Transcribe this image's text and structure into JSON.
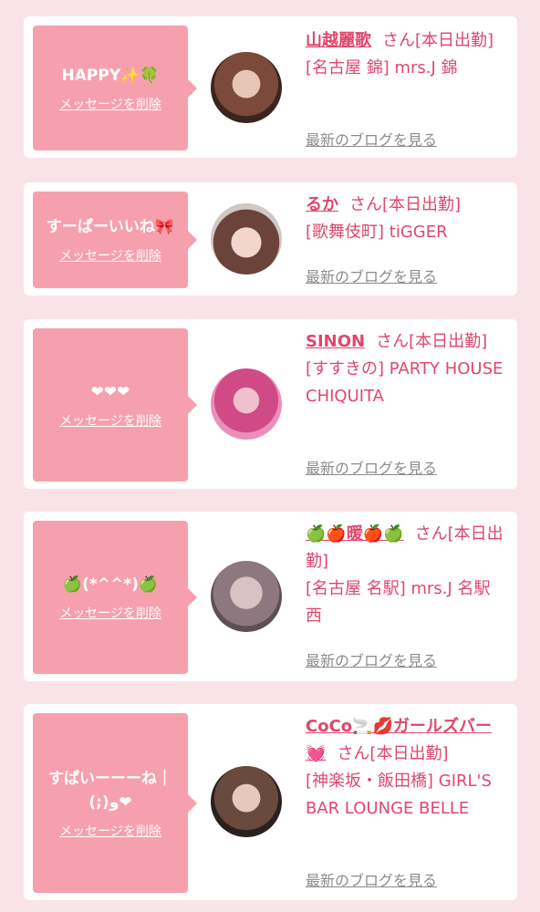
{
  "delete_label": "メッセージを削除",
  "blog_label": "最新のブログを見る",
  "suffix": "さん[本日出勤]",
  "cards": [
    {
      "message": "HAPPY✨🍀",
      "name": "山越麗歌",
      "shop": "[名古屋 錦] mrs.J 錦"
    },
    {
      "message": "すーぱーいいね🎀",
      "name": "るか",
      "shop": "[歌舞伎町] tiGGER"
    },
    {
      "message": "❤❤❤",
      "name": "SINON",
      "shop": "[すすきの] PARTY HOUSE CHIQUITA"
    },
    {
      "message": "🍏(*^^*)🍏",
      "name": "🍏🍎暖🍎🍏",
      "shop": "[名古屋 名駅] mrs.J 名駅西"
    },
    {
      "message": "すぱいーーーね｜(;)و❤",
      "name": "CoCo🚬💋ガールズバー💓",
      "shop": "[神楽坂・飯田橋] GIRL'S BAR LOUNGE BELLE"
    }
  ]
}
